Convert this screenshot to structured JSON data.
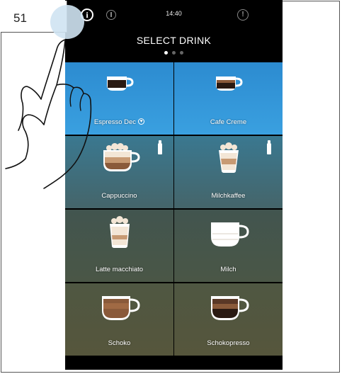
{
  "step_number": "51",
  "status": {
    "time": "14:40"
  },
  "title": "SELECT DRINK",
  "pager": {
    "count": 3,
    "active": 0
  },
  "drinks": [
    {
      "label": "Espresso Dec",
      "favorite": true,
      "milk": false
    },
    {
      "label": "Cafe Creme",
      "favorite": false,
      "milk": false
    },
    {
      "label": "Cappuccino",
      "favorite": false,
      "milk": true
    },
    {
      "label": "Milchkaffee",
      "favorite": false,
      "milk": true
    },
    {
      "label": "Latte macchiato",
      "favorite": false,
      "milk": false
    },
    {
      "label": "Milch",
      "favorite": false,
      "milk": false
    },
    {
      "label": "Schoko",
      "favorite": false,
      "milk": false
    },
    {
      "label": "Schokopresso",
      "favorite": false,
      "milk": false
    }
  ],
  "colors": {
    "active_tile": "#2c8bd0",
    "screen_background": "#000000",
    "espresso": "#2a1a12",
    "coffee": "#8a5a3a",
    "milk": "#f3e6d6"
  }
}
